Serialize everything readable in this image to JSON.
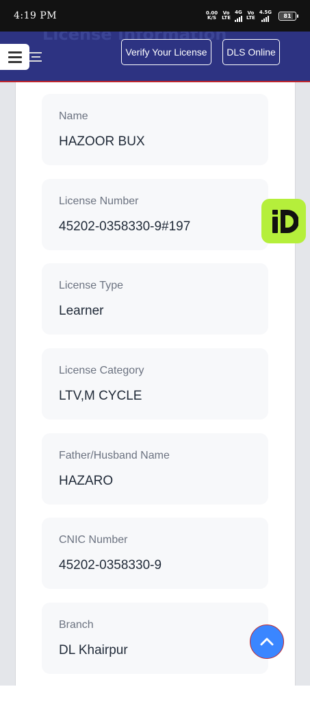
{
  "status_bar": {
    "time": "4:19 PM",
    "speed_top": "0.00",
    "speed_bottom": "K/S",
    "sim1_top": "Vo",
    "sim1_bottom": "LTE",
    "sim1_net": "4G",
    "sim2_top": "Vo",
    "sim2_bottom": "LTE",
    "sim2_net": "4.5G",
    "battery": "81"
  },
  "header": {
    "bg_title": "License Information",
    "verify_label": "Verify Your License",
    "dls_label": "DLS Online",
    "accent_color": "#2d3382",
    "border_color": "#c0262d"
  },
  "fields": [
    {
      "label": "Name",
      "value": "HAZOOR BUX"
    },
    {
      "label": "License Number",
      "value": "45202-0358330-9#197"
    },
    {
      "label": "License Type",
      "value": "Learner"
    },
    {
      "label": "License Category",
      "value": "LTV,M CYCLE"
    },
    {
      "label": "Father/Husband Name",
      "value": "HAZARO"
    },
    {
      "label": "CNIC Number",
      "value": "45202-0358330-9"
    },
    {
      "label": "Branch",
      "value": "DL Khairpur"
    }
  ],
  "widgets": {
    "id_widget_icon": "id-logo-icon",
    "scroll_top_icon": "chevron-up-icon"
  }
}
